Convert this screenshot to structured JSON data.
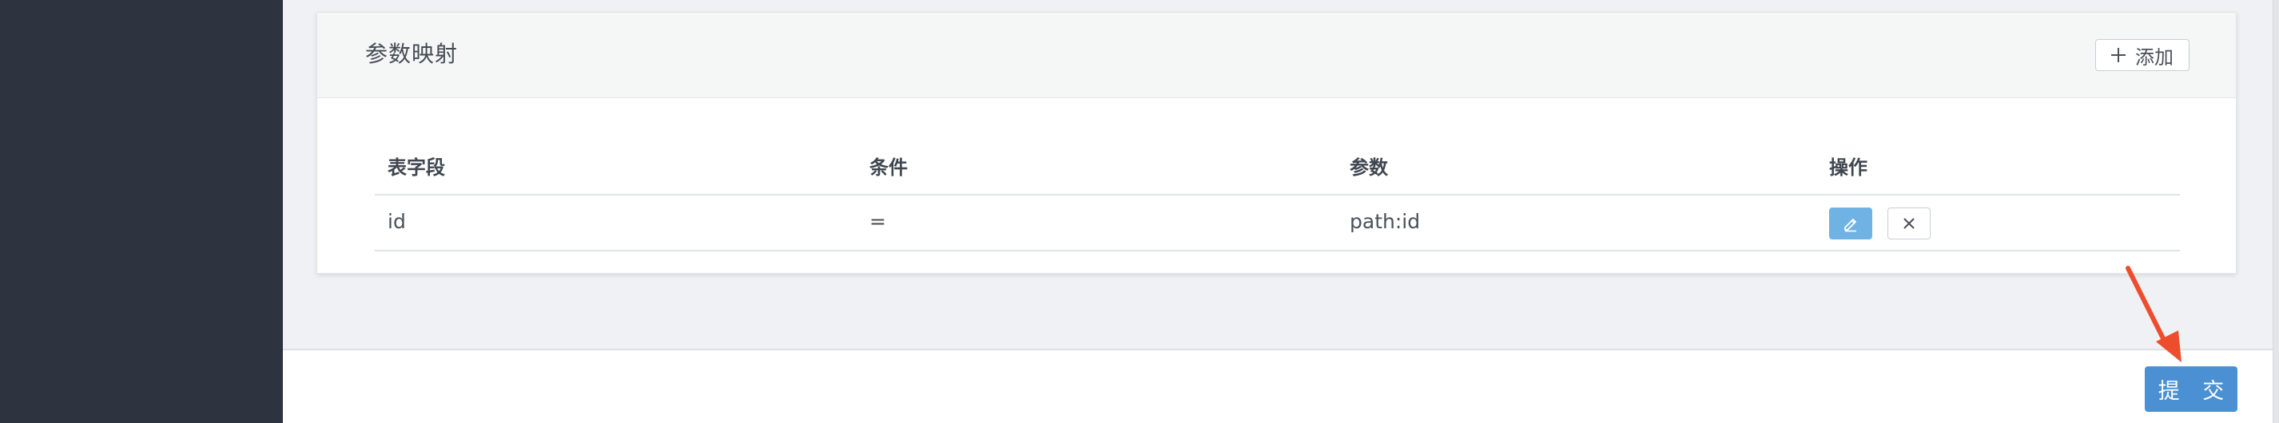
{
  "card": {
    "title": "参数映射",
    "add_label": "添加"
  },
  "table": {
    "headers": [
      "表字段",
      "条件",
      "参数",
      "操作"
    ],
    "rows": [
      {
        "field": "id",
        "condition": "=",
        "param": "path:id"
      }
    ]
  },
  "footer": {
    "submit_label": "提 交"
  },
  "colors": {
    "sidebar": "#2d333f",
    "accent": "#4a90d2",
    "edit_button": "#6fb3e5",
    "annotation_arrow": "#ee4d2d"
  },
  "icons": {
    "add": "plus-icon",
    "edit": "pencil-icon",
    "delete": "close-icon",
    "annotation": "arrow-icon"
  }
}
